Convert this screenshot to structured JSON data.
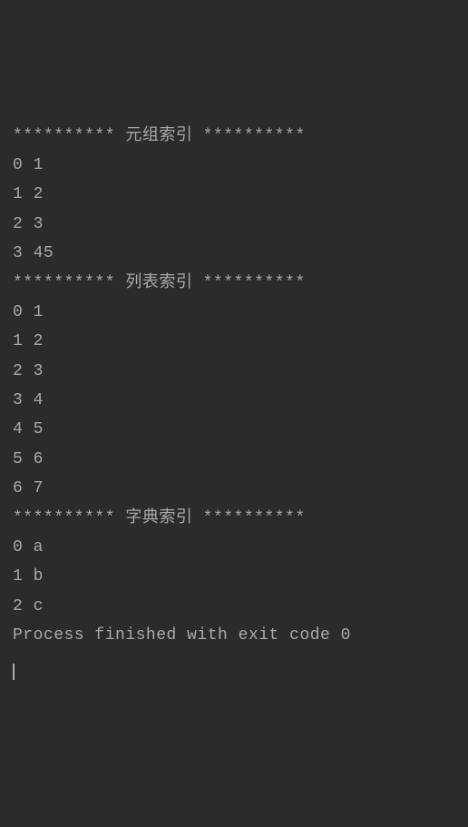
{
  "console": {
    "sections": [
      {
        "header": "********** 元组索引 **********",
        "rows": [
          "0 1",
          "1 2",
          "2 3",
          "3 45"
        ]
      },
      {
        "header": "********** 列表索引 **********",
        "rows": [
          "0 1",
          "1 2",
          "2 3",
          "3 4",
          "4 5",
          "5 6",
          "6 7"
        ]
      },
      {
        "header": "********** 字典索引 **********",
        "rows": [
          "0 a",
          "1 b",
          "2 c"
        ]
      }
    ],
    "footer": "Process finished with exit code 0"
  }
}
